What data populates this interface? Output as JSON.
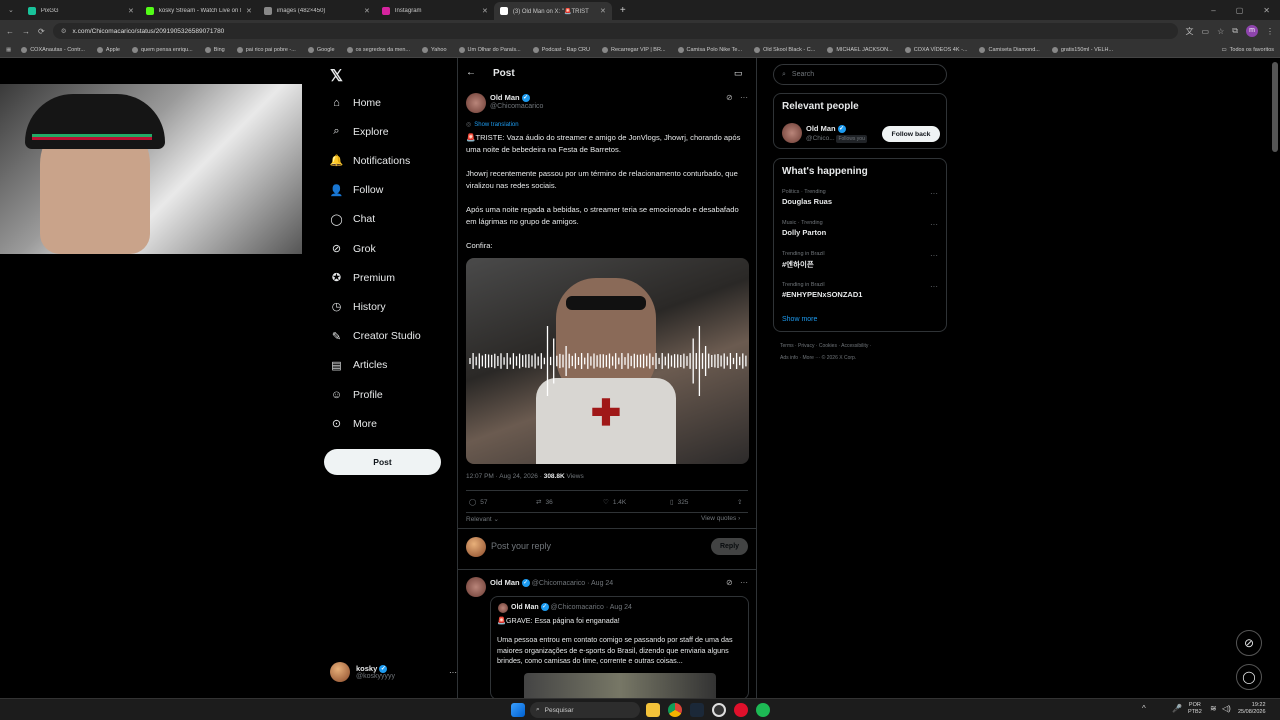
{
  "browser": {
    "tabs": [
      {
        "title": "PixGG",
        "color": "#19c39b",
        "active": false
      },
      {
        "title": "kosky Stream - Watch Live on K",
        "color": "#53fc18",
        "active": false
      },
      {
        "title": "images (482×450)",
        "color": "#888888",
        "active": false
      },
      {
        "title": "Instagram",
        "color": "#d6249f",
        "active": false
      },
      {
        "title": "(3) Old Man on X: \"🚨TRIST",
        "color": "#ffffff",
        "active": true
      }
    ],
    "url": "x.com/Chicomacarico/status/2091905326589071780",
    "bookmarks": [
      "COXAnautas - Contr...",
      "Apple",
      "quem pensa enriqu...",
      "Bing",
      "pai rico pai pobre -...",
      "Google",
      "os segredos da men...",
      "Yahoo",
      "Um Olhar do Paraís...",
      "Podcast - Rap CRU",
      "Recarregar VIP | BR...",
      "Camisa Polo Nike Te...",
      "Old Skool Black - C...",
      "MICHAEL JACKSON...",
      "COXA VÍDEOS 4K -...",
      "Camiseta Diamond...",
      "gratis150ml - VELH..."
    ],
    "bookmarks_all": "Todos os favoritos"
  },
  "nav": {
    "items": [
      "Home",
      "Explore",
      "Notifications",
      "Follow",
      "Chat",
      "Grok",
      "Premium",
      "History",
      "Creator Studio",
      "Articles",
      "Profile",
      "More"
    ],
    "post_button": "Post",
    "account_name": "kosky",
    "account_handle": "@koskyyyyy"
  },
  "post": {
    "header": "Post",
    "author_name": "Old Man",
    "author_handle": "@Chicomacarico",
    "show_translation": "Show translation",
    "p1": "🚨TRISTE: Vaza áudio do streamer e amigo de JonVlogs, Jhowrj, chorando após uma noite de bebedeira na Festa de Barretos.",
    "p2": "Jhowrj recentemente passou por um término de relacionamento conturbado, que viralizou nas redes sociais.",
    "p3": "Após uma noite regada a bebidas, o streamer teria se emocionado e desabafado em lágrimas no grupo de amigos.",
    "p4": "Confira:",
    "time": "12:07 PM · Aug 24, 2026 · ",
    "views": "308.8K",
    "views_label": " Views",
    "replies": "57",
    "reposts": "36",
    "likes": "1.4K",
    "bookmarks": "325",
    "relevant": "Relevant",
    "view_quotes": "View quotes",
    "reply_placeholder": "Post your reply",
    "reply_button": "Reply"
  },
  "reply": {
    "author_name": "Old Man",
    "author_handle": "@Chicomacarico · Aug 24",
    "quote_name": "Old Man",
    "quote_handle": "@Chicomacarico · Aug 24",
    "quote_title": "🚨GRAVE: Essa página foi enganada!",
    "quote_body": "Uma pessoa entrou em contato comigo se passando por staff de uma das maiores organizações de e-sports do Brasil, dizendo que enviaria alguns brindes, como camisas do time, corrente e outras coisas..."
  },
  "right": {
    "search_placeholder": "Search",
    "relevant_title": "Relevant people",
    "person_name": "Old Man",
    "person_handle": "@Chico...",
    "follows_you": "Follows you",
    "follow_back": "Follow back",
    "happening_title": "What's happening",
    "trends": [
      {
        "category": "Politics · Trending",
        "name": "Douglas Ruas"
      },
      {
        "category": "Music · Trending",
        "name": "Dolly Parton"
      },
      {
        "category": "Trending in Brazil",
        "name": "#엔하이픈"
      },
      {
        "category": "Trending in Brazil",
        "name": "#ENHYPENxSONZAD1"
      }
    ],
    "show_more": "Show more",
    "footer1": "Terms · Privacy · Cookies · Accessibility ·",
    "footer2": "Ads info · More ··· © 2026 X Corp."
  },
  "taskbar": {
    "search": "Pesquisar",
    "lang1": "POR",
    "lang2": "PTB2",
    "time": "19:22",
    "date": "25/08/2026"
  }
}
